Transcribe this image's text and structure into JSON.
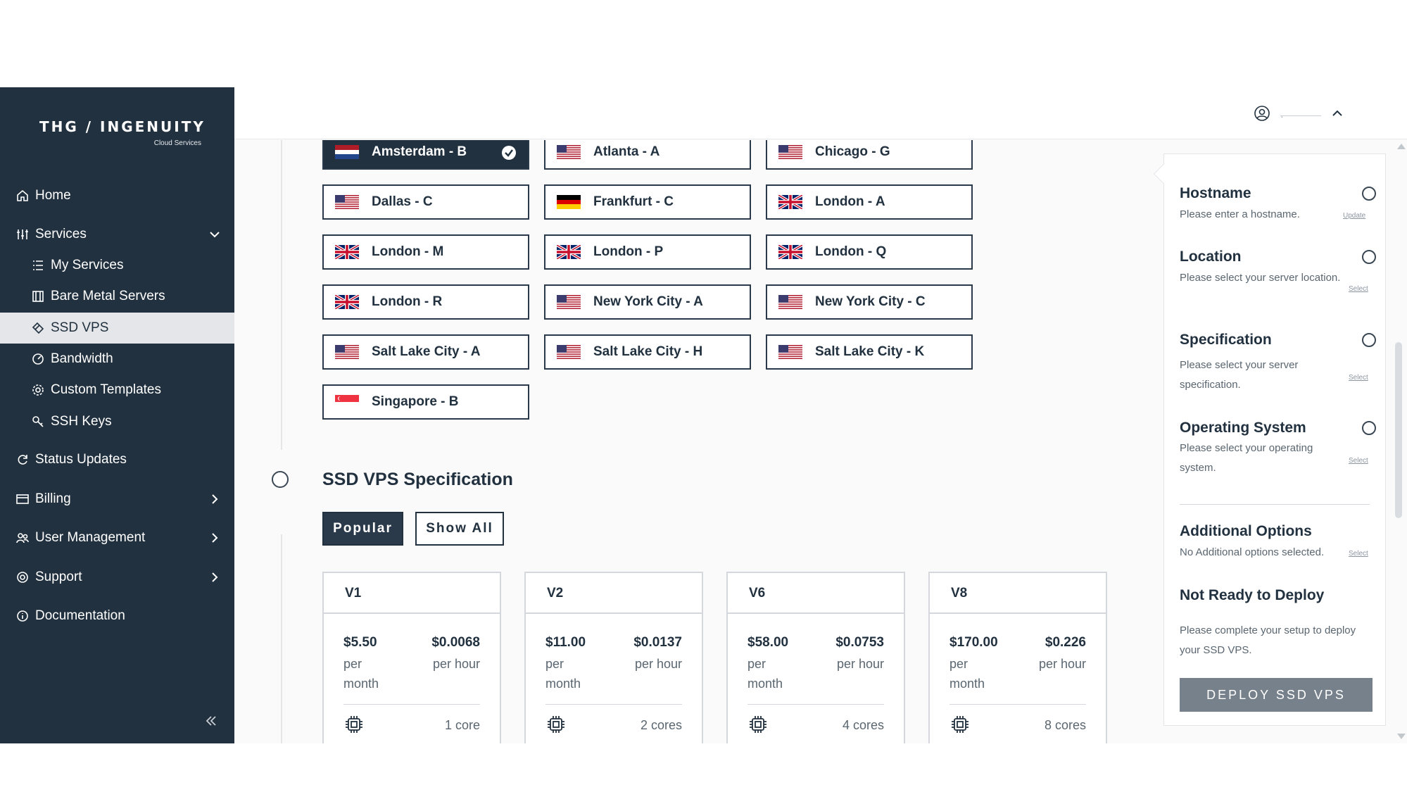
{
  "brand": {
    "name": "THG / INGENUITY",
    "tagline": "Cloud Services"
  },
  "sidebar": {
    "items": [
      {
        "label": "Home",
        "icon": "home-icon"
      },
      {
        "label": "Services",
        "icon": "sliders-icon",
        "expanded": true
      },
      {
        "label": "My Services",
        "icon": "list-icon"
      },
      {
        "label": "Bare Metal Servers",
        "icon": "server-icon"
      },
      {
        "label": "SSD VPS",
        "icon": "vps-icon",
        "active": true
      },
      {
        "label": "Bandwidth",
        "icon": "gauge-icon"
      },
      {
        "label": "Custom Templates",
        "icon": "gear-icon"
      },
      {
        "label": "SSH Keys",
        "icon": "key-icon"
      },
      {
        "label": "Status Updates",
        "icon": "refresh-icon"
      },
      {
        "label": "Billing",
        "icon": "card-icon"
      },
      {
        "label": "User Management",
        "icon": "users-icon"
      },
      {
        "label": "Support",
        "icon": "lifebuoy-icon"
      },
      {
        "label": "Documentation",
        "icon": "info-icon"
      }
    ]
  },
  "header": {
    "user_name": "·"
  },
  "locations": [
    {
      "label": "Amsterdam - B",
      "flag": "nl",
      "selected": true
    },
    {
      "label": "Atlanta - A",
      "flag": "us"
    },
    {
      "label": "Chicago - G",
      "flag": "us"
    },
    {
      "label": "Dallas - C",
      "flag": "us"
    },
    {
      "label": "Frankfurt - C",
      "flag": "de"
    },
    {
      "label": "London - A",
      "flag": "gb"
    },
    {
      "label": "London - M",
      "flag": "gb"
    },
    {
      "label": "London - P",
      "flag": "gb"
    },
    {
      "label": "London - Q",
      "flag": "gb"
    },
    {
      "label": "London - R",
      "flag": "gb"
    },
    {
      "label": "New York City - A",
      "flag": "us"
    },
    {
      "label": "New York City - C",
      "flag": "us"
    },
    {
      "label": "Salt Lake City - A",
      "flag": "us"
    },
    {
      "label": "Salt Lake City - H",
      "flag": "us"
    },
    {
      "label": "Salt Lake City - K",
      "flag": "us"
    },
    {
      "label": "Singapore - B",
      "flag": "sg"
    }
  ],
  "spec": {
    "title": "SSD VPS Specification",
    "tabs": {
      "popular": "Popular",
      "show_all": "Show All"
    },
    "plans": [
      {
        "name": "V1",
        "monthly": "$5.50",
        "monthly_unit_1": "per",
        "monthly_unit_2": "month",
        "hourly": "$0.0068",
        "hourly_unit": "per hour",
        "cores": "1 core"
      },
      {
        "name": "V2",
        "monthly": "$11.00",
        "monthly_unit_1": "per",
        "monthly_unit_2": "month",
        "hourly": "$0.0137",
        "hourly_unit": "per hour",
        "cores": "2 cores"
      },
      {
        "name": "V6",
        "monthly": "$58.00",
        "monthly_unit_1": "per",
        "monthly_unit_2": "month",
        "hourly": "$0.0753",
        "hourly_unit": "per hour",
        "cores": "4 cores"
      },
      {
        "name": "V8",
        "monthly": "$170.00",
        "monthly_unit_1": "per",
        "monthly_unit_2": "month",
        "hourly": "$0.226",
        "hourly_unit": "per hour",
        "cores": "8 cores"
      }
    ]
  },
  "summary": {
    "hostname": {
      "title": "Hostname",
      "desc": "Please enter a hostname.",
      "link": "Update"
    },
    "location": {
      "title": "Location",
      "desc": "Please select your server location.",
      "link": "Select"
    },
    "specification": {
      "title": "Specification",
      "desc": "Please select your server specification.",
      "link": "Select"
    },
    "os": {
      "title": "Operating System",
      "desc": "Please select your operating system.",
      "link": "Select"
    },
    "additional": {
      "title": "Additional Options",
      "desc": "No Additional options selected.",
      "link": "Select"
    },
    "status_title": "Not Ready to Deploy",
    "status_desc": "Please complete your setup to deploy your SSD VPS.",
    "deploy_label": "DEPLOY SSD VPS"
  },
  "colors": {
    "sidebar_bg": "#22313f",
    "accent": "#2a3a4a",
    "deploy_disabled": "#77818b"
  }
}
